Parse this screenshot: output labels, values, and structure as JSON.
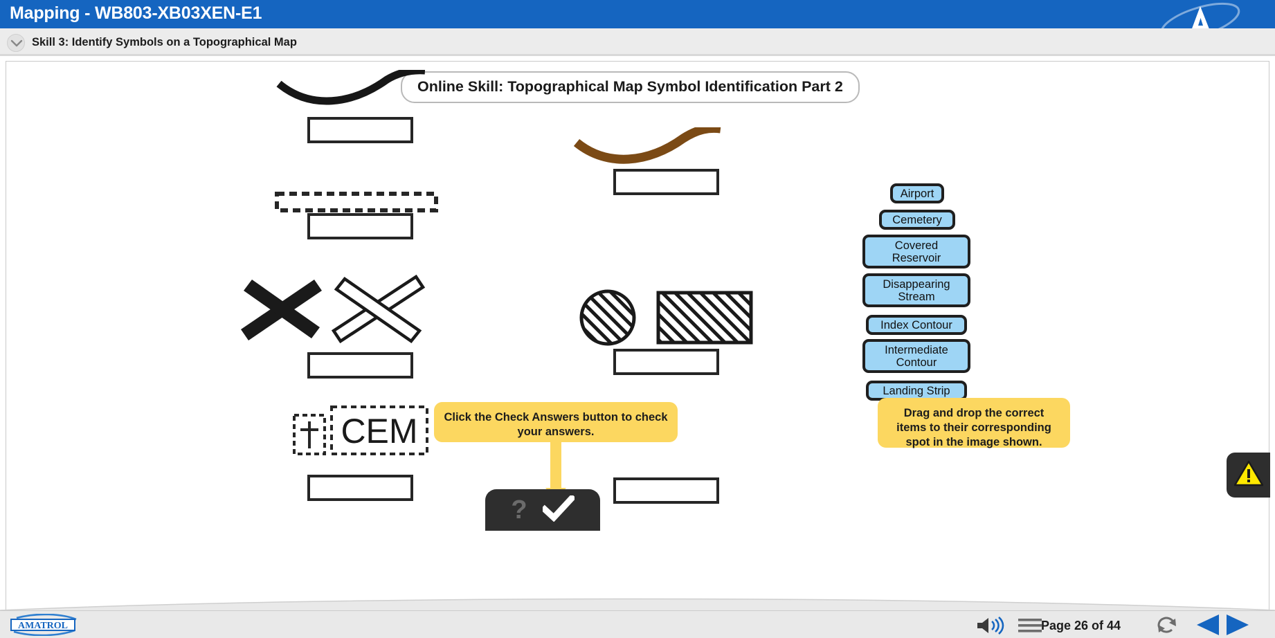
{
  "window": {
    "title": "Mapping - WB803-XB03XEN-E1",
    "logo_icon": "amatrol-a-logo-icon"
  },
  "subheader": {
    "collapse_icon": "chevron-down-icon",
    "skill_label": "Skill 3: Identify Symbols on a Topographical Map"
  },
  "stage": {
    "banner": "Online Skill: Topographical Map Symbol Identification Part 2"
  },
  "symbols": [
    {
      "name": "index-contour-symbol",
      "description": "black curved contour line"
    },
    {
      "name": "landing-strip-symbol",
      "description": "dashed outline rectangle"
    },
    {
      "name": "airport-symbol",
      "description": "filled X and outlined X runway crossing"
    },
    {
      "name": "cemetery-symbol",
      "description": "dashed box with cross and dashed box labeled CEM",
      "label": "CEM"
    },
    {
      "name": "intermediate-contour-symbol",
      "description": "brown curved contour line"
    },
    {
      "name": "covered-reservoir-symbol",
      "description": "hatched circle and hatched rectangle"
    }
  ],
  "dropboxes": [
    {
      "name": "dropbox-index-contour",
      "value": ""
    },
    {
      "name": "dropbox-landing-strip",
      "value": ""
    },
    {
      "name": "dropbox-airport",
      "value": ""
    },
    {
      "name": "dropbox-cemetery",
      "value": ""
    },
    {
      "name": "dropbox-intermediate-contour",
      "value": ""
    },
    {
      "name": "dropbox-covered-reservoir",
      "value": ""
    },
    {
      "name": "dropbox-disappearing-stream",
      "value": ""
    }
  ],
  "chips": [
    {
      "label": "Airport"
    },
    {
      "label": "Cemetery"
    },
    {
      "label": "Covered\nReservoir"
    },
    {
      "label": "Disappearing\nStream"
    },
    {
      "label": "Index Contour"
    },
    {
      "label": "Intermediate\nContour"
    },
    {
      "label": "Landing Strip"
    }
  ],
  "tooltips": {
    "check_answers": "Click the Check Answers button to check your answers.",
    "drag_drop": "Drag and drop the correct items to their corresponding spot in the image shown."
  },
  "checkbar": {
    "help_icon": "question-mark-icon",
    "check_icon": "checkmark-icon"
  },
  "warning": {
    "icon": "warning-triangle-icon"
  },
  "bottombar": {
    "brand": "AMATROL",
    "volume_icon": "speaker-volume-icon",
    "menu_icon": "hamburger-menu-icon",
    "page_label": "Page 26 of 44",
    "refresh_icon": "refresh-icon",
    "prev_icon": "previous-page-arrow-icon",
    "next_icon": "next-page-arrow-icon"
  },
  "colors": {
    "titlebar_blue": "#1565c0",
    "chip_blue": "#9ed5f5",
    "tooltip_yellow": "#fcd760",
    "contour_brown": "#7b4a15",
    "warning_yellow": "#ffe800",
    "nav_blue": "#1565c0"
  }
}
